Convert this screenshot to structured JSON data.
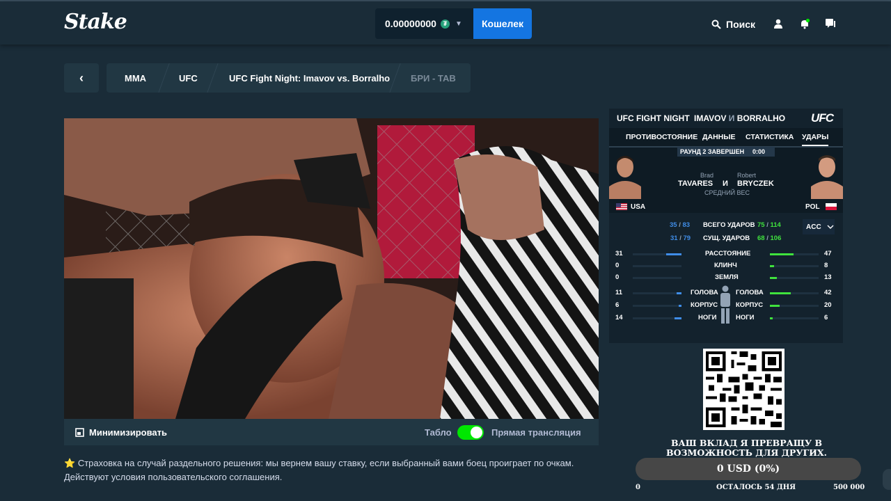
{
  "header": {
    "logo": "Stake",
    "balance": "0.00000000",
    "currency_icon": "tether-icon",
    "wallet_label": "Кошелек",
    "search_label": "Поиск"
  },
  "breadcrumb": {
    "items": [
      "MMA",
      "UFC",
      "UFC Fight Night: Imavov vs. Borralho",
      "БРИ - ТАВ"
    ]
  },
  "video_bar": {
    "minimize_label": "Минимизировать",
    "scoreboard_label": "Табло",
    "live_label": "Прямая трансляция"
  },
  "note": {
    "star": "⭐",
    "text": "Страховка на случай раздельного решения: мы вернем вашу ставку, если выбранный вами боец проиграет по очкам. Действуют условия пользовательского соглашения."
  },
  "scoreboard": {
    "event": "UFC FIGHT NIGHT",
    "bout_a": "IMAVOV",
    "bout_and": "И",
    "bout_b": "BORRALHO",
    "brand": "UFC",
    "tabs": [
      "ПРОТИВОСТОЯНИЕ",
      "ДАННЫЕ",
      "СТАТИСТИКА",
      "УДАРЫ"
    ],
    "round_status": "РАУНД 2 ЗАВЕРШЕН",
    "clock": "0:00",
    "left_first": "Brad",
    "left_last": "TAVARES",
    "vs": "И",
    "right_first": "Robert",
    "right_last": "BRYCZEK",
    "weight_class": "СРЕДНИЙ ВЕС",
    "left_country": "USA",
    "right_country": "POL",
    "totals": [
      {
        "label": "ВСЕГО УДАРОВ",
        "l_a": "35",
        "l_b": "83",
        "r_a": "75",
        "r_b": "114"
      },
      {
        "label": "СУЩ. УДАРОВ",
        "l_a": "31",
        "l_b": "79",
        "r_a": "68",
        "r_b": "106"
      }
    ],
    "acc_label": "ACC",
    "positions": [
      {
        "label": "РАССТОЯНИЕ",
        "left": "31",
        "right": "47"
      },
      {
        "label": "КЛИНЧ",
        "left": "0",
        "right": "8"
      },
      {
        "label": "ЗЕМЛЯ",
        "left": "0",
        "right": "13"
      }
    ],
    "targets": [
      {
        "label_l": "ГОЛОВА",
        "label_r": "ГОЛОВА",
        "left": "11",
        "right": "42"
      },
      {
        "label_l": "КОРПУС",
        "label_r": "КОРПУС",
        "left": "6",
        "right": "20"
      },
      {
        "label_l": "НОГИ",
        "label_r": "НОГИ",
        "left": "14",
        "right": "6"
      }
    ]
  },
  "donation": {
    "title": "ВАШ ВКЛАД Я ПРЕВРАЩУ В ВОЗМОЖНОСТЬ ДЛЯ ДРУГИХ.",
    "progress": "0 USD (0%)",
    "min": "0",
    "remaining": "ОСТАЛОСЬ 54 ДНЯ",
    "goal": "500 000",
    "progress_fraction": 0
  }
}
